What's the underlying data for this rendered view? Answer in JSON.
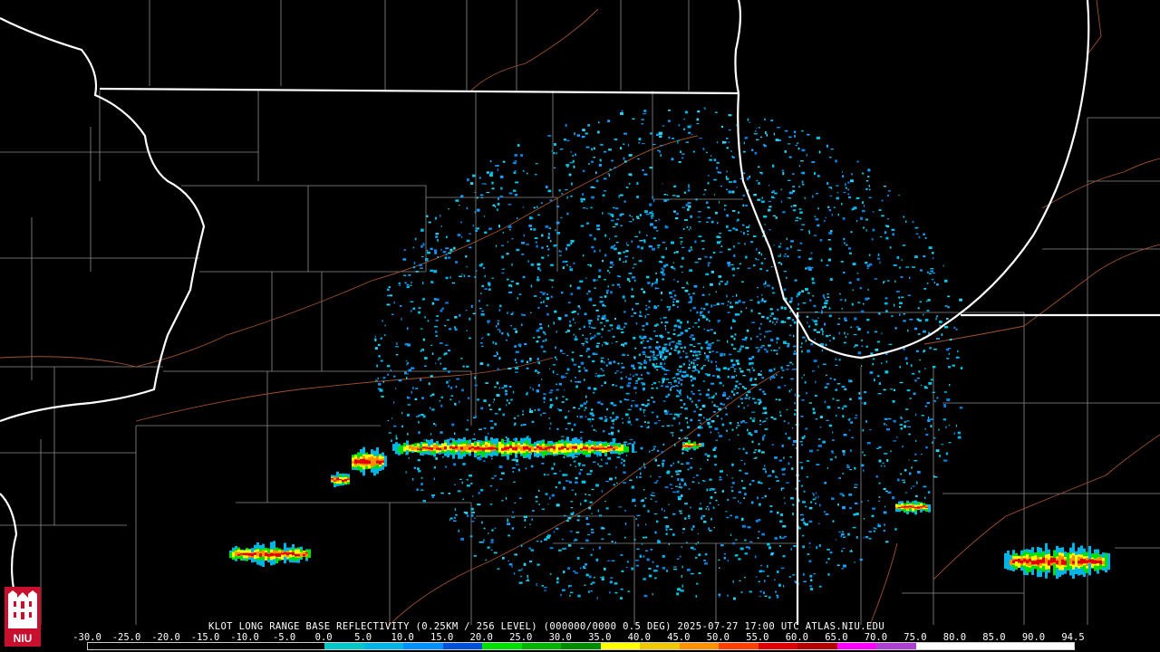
{
  "title": "KLOT LONG RANGE BASE REFLECTIVITY (0.25KM / 256 LEVEL) (000000/0000 0.5 DEG) 2025-07-27 17:00 UTC  ATLAS.NIU.EDU",
  "logo_text": "NIU",
  "colorbar": {
    "labels": [
      "-30.0",
      "-25.0",
      "-20.0",
      "-15.0",
      "-10.0",
      "-5.0",
      "0.0",
      "5.0",
      "10.0",
      "15.0",
      "20.0",
      "25.0",
      "30.0",
      "35.0",
      "40.0",
      "45.0",
      "50.0",
      "55.0",
      "60.0",
      "65.0",
      "70.0",
      "75.0",
      "80.0",
      "85.0",
      "90.0",
      "94.5"
    ],
    "colors": [
      "#000000",
      "#000000",
      "#000000",
      "#000000",
      "#000000",
      "#000000",
      "#00c8c8",
      "#00b4e6",
      "#0090ff",
      "#0050d8",
      "#00e000",
      "#00b400",
      "#008c00",
      "#ffff00",
      "#f0c800",
      "#ff9000",
      "#ff4000",
      "#e00000",
      "#b40000",
      "#ff00ff",
      "#b040d0",
      "#ffffff",
      "#ffffff",
      "#ffffff",
      "#ffffff"
    ]
  },
  "colors": {
    "state_border": "#ffffff",
    "county_border": "#a0a0a0",
    "rivers": "#b05a2a",
    "radar_center": "#000000"
  }
}
